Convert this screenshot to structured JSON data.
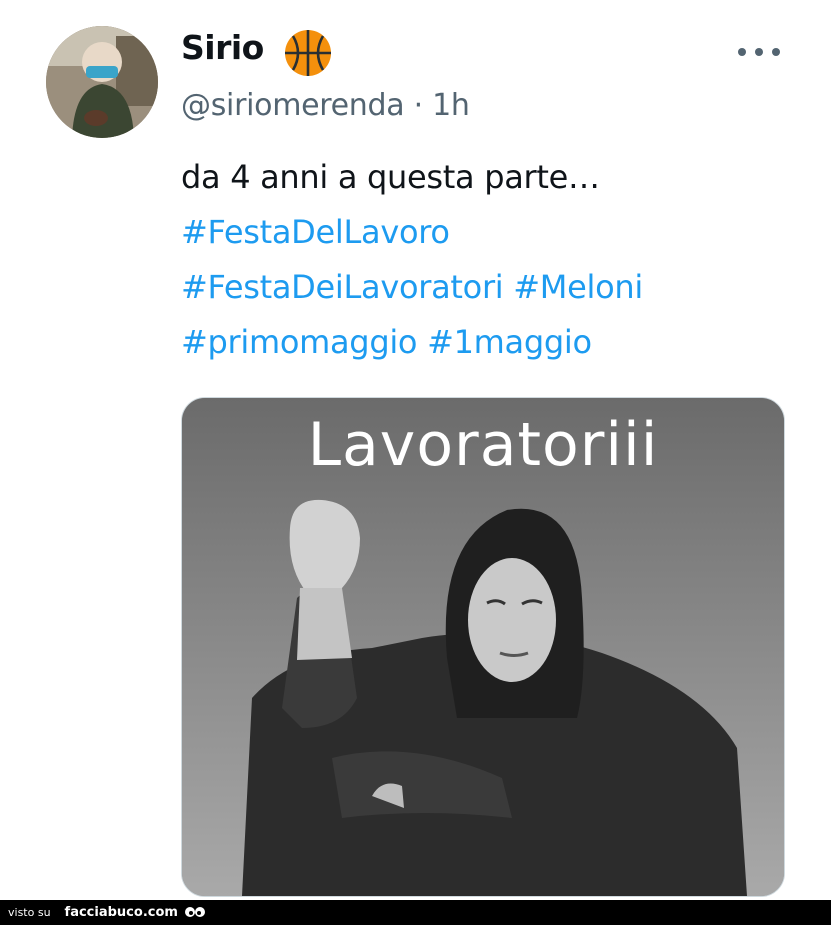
{
  "tweet": {
    "author_name": "Sirio",
    "author_emoji": "basketball-emoji",
    "handle": "@siriomerenda",
    "separator": "·",
    "time_ago": "1h",
    "more_label": "more-options",
    "text_lines": [
      {
        "plain": "da 4 anni a questa parte…"
      },
      {
        "tags": [
          "#FestaDelLavoro"
        ]
      },
      {
        "tags": [
          "#FestaDeiLavoratori",
          "#Meloni"
        ]
      },
      {
        "tags": [
          "#primomaggio",
          "#1maggio"
        ]
      }
    ],
    "hashtag_color": "#1d9bf0",
    "media": {
      "caption": "Lavoratoriii"
    }
  },
  "footer": {
    "visto": "visto su",
    "site": "facciabuco.com"
  }
}
